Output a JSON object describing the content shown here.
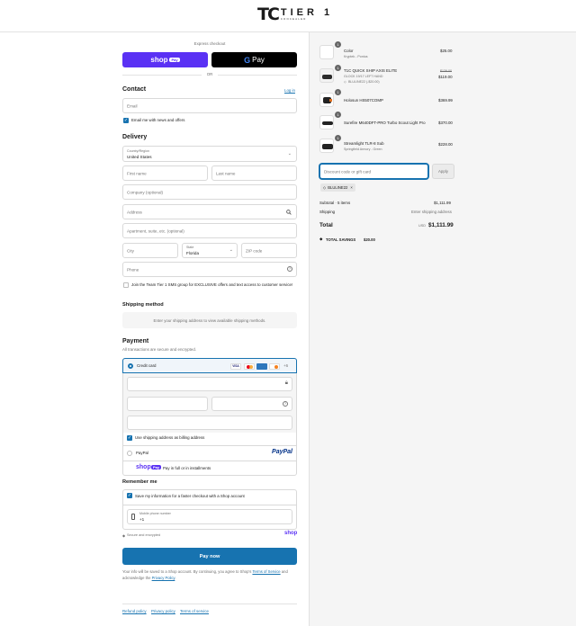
{
  "header": {
    "logo_mark": "TC",
    "logo_name": "TIER 1",
    "logo_sub": "CONCEALED"
  },
  "express": {
    "label": "Express checkout",
    "shop_pay": "shop",
    "shop_pay_badge": "Pay",
    "gpay": "Pay",
    "or": "OR"
  },
  "contact": {
    "title": "Contact",
    "login": "Log in",
    "email_placeholder": "Email",
    "news_label": "Email me with news and offers"
  },
  "delivery": {
    "title": "Delivery",
    "country_label": "Country/Region",
    "country_value": "United States",
    "first_name": "First name",
    "last_name": "Last name",
    "company": "Company (optional)",
    "address": "Address",
    "apartment": "Apartment, suite, etc. (optional)",
    "city": "City",
    "state_label": "State",
    "state_value": "Florida",
    "zip": "ZIP code",
    "phone": "Phone",
    "sms_label": "Join the Team Tier 1 SMS group for EXCLUSIVE offers and text access to customer service!"
  },
  "shipping": {
    "title": "Shipping method",
    "message": "Enter your shipping address to view available shipping methods."
  },
  "payment": {
    "title": "Payment",
    "subtitle": "All transactions are secure and encrypted.",
    "credit_card": "Credit card",
    "card_more": "+6",
    "billing_label": "Use shipping address as billing address",
    "paypal": "PayPal",
    "paypal_logo": "PayPal",
    "shoppay_logo": "shop",
    "shoppay_badge": "Pay",
    "shoppay_text": "Pay in full or in installments"
  },
  "remember": {
    "title": "Remember me",
    "save_label": "Save my information for a faster checkout with a Shop account",
    "mobile_label": "Mobile phone number",
    "mobile_value": "+1",
    "secure": "Secure and encrypted",
    "shop_logo": "shop"
  },
  "pay_now": "Pay now",
  "legal": {
    "text1": "Your info will be saved to a Shop account. By continuing, you agree to Shop's ",
    "terms": "Terms of Service",
    "text2": "and acknowledge the ",
    "privacy": "Privacy Policy",
    "end": "."
  },
  "footer": {
    "refund": "Refund policy",
    "privacy": "Privacy policy",
    "terms": "Terms of service"
  },
  "summary": {
    "items": [
      {
        "qty": "1",
        "name": "Color",
        "sub": "Kryptek - Pontus",
        "price": "$25.00",
        "old_price": "",
        "discount": ""
      },
      {
        "qty": "1",
        "name": "T1C QUICK SHIP AXIS ELITE",
        "sub": "GLOCK 19/17 LEFT HAND",
        "price": "$119.00",
        "old_price": "$139.00",
        "discount": "BLULINE22 (-$20.00)"
      },
      {
        "qty": "1",
        "name": "Holosun HS507COMP",
        "sub": "",
        "price": "$369.99",
        "old_price": "",
        "discount": ""
      },
      {
        "qty": "1",
        "name": "Surefire M640DFT-PRO Turbo Scout Light Pro",
        "sub": "",
        "price": "$370.00",
        "old_price": "",
        "discount": ""
      },
      {
        "qty": "1",
        "name": "Streamlight TLR-8 Sub",
        "sub": "Springfield Armory - Green",
        "price": "$228.00",
        "old_price": "",
        "discount": ""
      }
    ],
    "discount_placeholder": "Discount code or gift card",
    "apply": "Apply",
    "code_tag": "BLULINE22",
    "subtotal_label": "Subtotal · 5 items",
    "subtotal_value": "$1,111.99",
    "shipping_label": "Shipping",
    "shipping_value": "Enter shipping address",
    "total_label": "Total",
    "currency": "USD",
    "total_value": "$1,111.99",
    "savings_label": "TOTAL SAVINGS",
    "savings_value": "$20.00"
  },
  "colors": {
    "accent": "#1773b0",
    "shop_purple": "#5a31f4",
    "page_bg": "#ffffff",
    "summary_bg": "#f5f5f5"
  }
}
